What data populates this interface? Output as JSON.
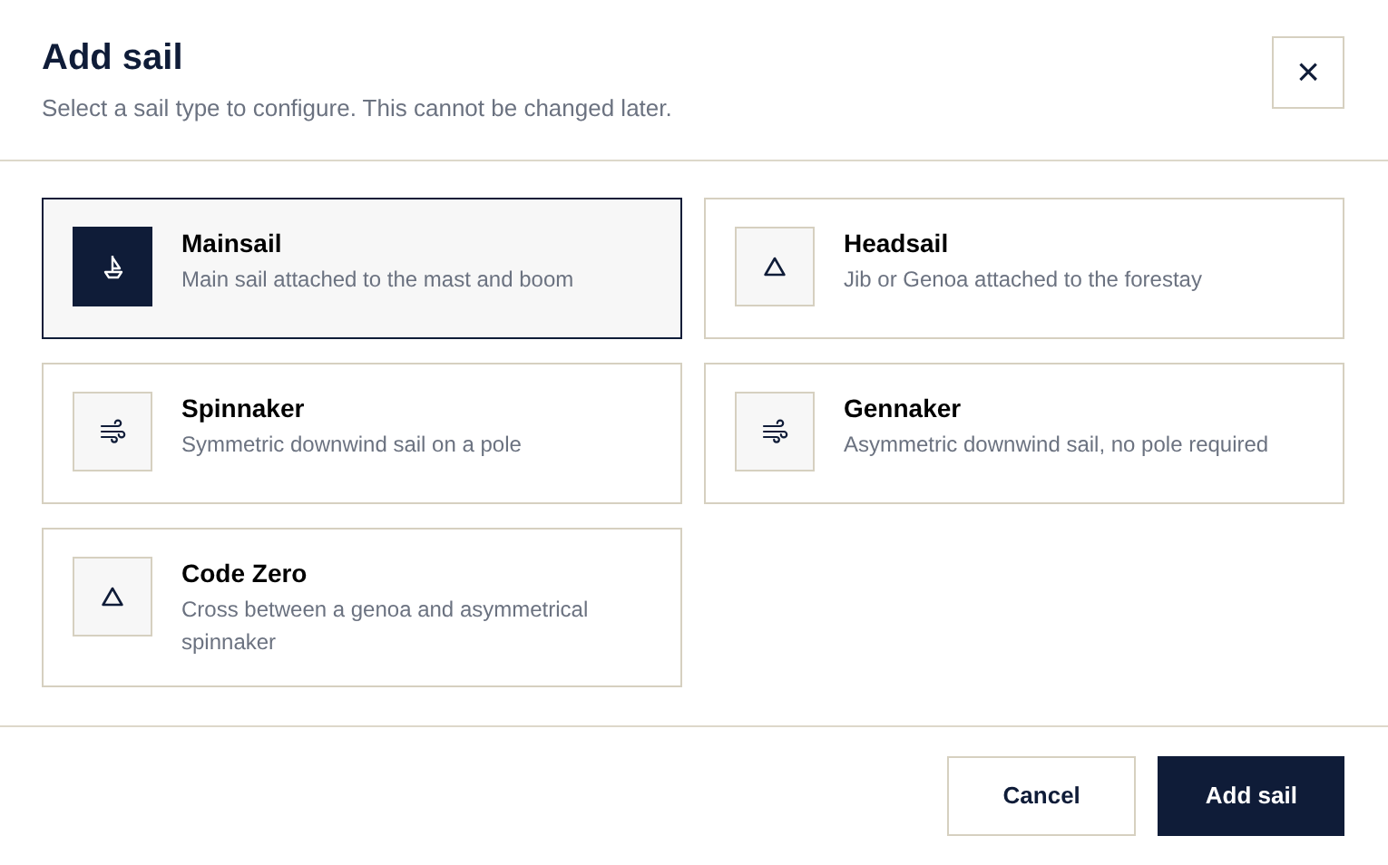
{
  "dialog": {
    "title": "Add sail",
    "subtitle": "Select a sail type to configure. This cannot be changed later.",
    "close_label": "×"
  },
  "options": [
    {
      "title": "Mainsail",
      "description": "Main sail attached to the mast and boom",
      "kind": "boat",
      "selected": true
    },
    {
      "title": "Headsail",
      "description": "Jib or Genoa attached to the forestay",
      "kind": "triangle",
      "selected": false
    },
    {
      "title": "Spinnaker",
      "description": "Symmetric downwind sail on a pole",
      "kind": "wind",
      "selected": false
    },
    {
      "title": "Gennaker",
      "description": "Asymmetric downwind sail, no pole required",
      "kind": "wind",
      "selected": false
    },
    {
      "title": "Code Zero",
      "description": "Cross between a genoa and asymmetrical spinnaker",
      "kind": "triangle",
      "selected": false
    }
  ],
  "buttons": [
    {
      "label": "Cancel",
      "kind": "secondary"
    },
    {
      "label": "Add sail",
      "kind": "primary"
    }
  ]
}
